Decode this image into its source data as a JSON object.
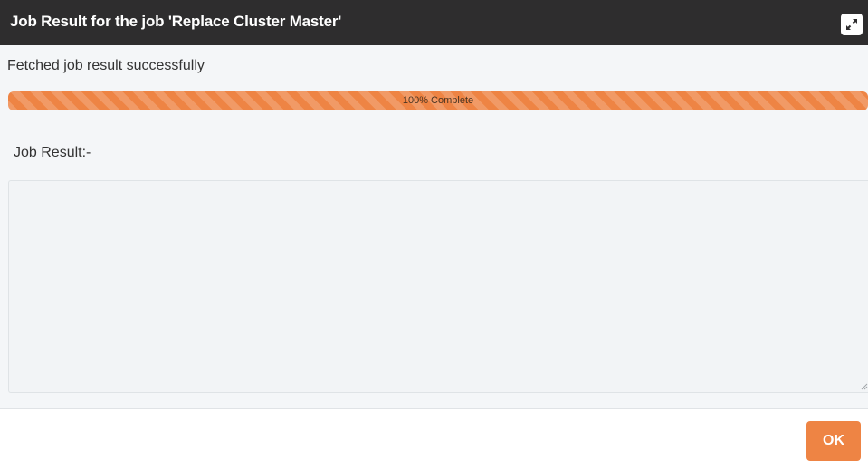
{
  "dialog": {
    "title": "Job Result for the job 'Replace Cluster Master'",
    "expand_icon": "expand-arrows-icon"
  },
  "status": {
    "message": "Fetched job result successfully"
  },
  "progress": {
    "percent": 100,
    "label": "100% Complete",
    "color": "#ee8444"
  },
  "job_result": {
    "label": "Job Result:-",
    "value": ""
  },
  "footer": {
    "ok_label": "OK"
  },
  "colors": {
    "titlebar_bg": "#2e2d2e",
    "accent": "#ee8444",
    "panel_bg": "#f4f6f8"
  }
}
